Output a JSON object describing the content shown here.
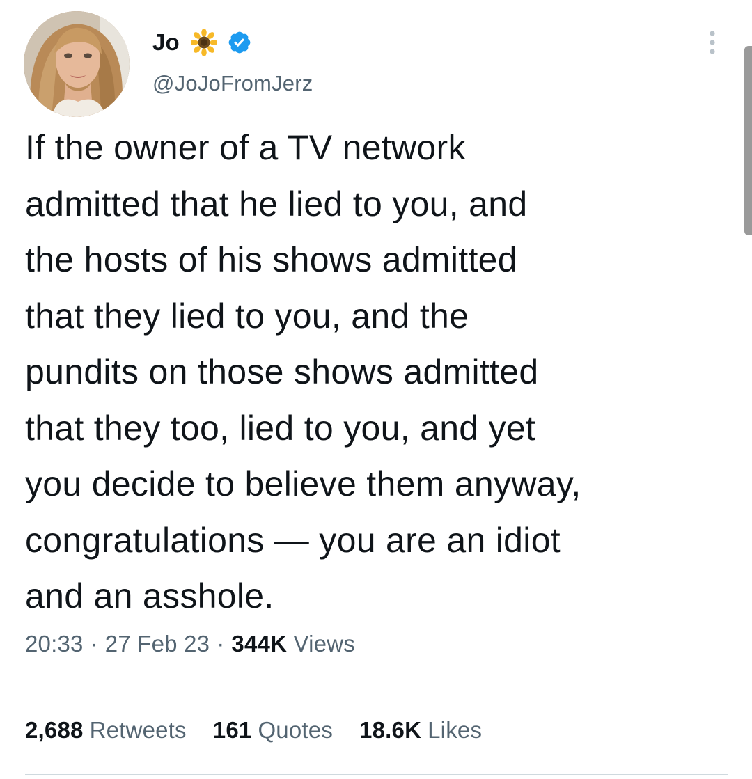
{
  "author": {
    "display_name": "Jo",
    "emoji_icon": "sunflower-icon",
    "verified_icon": "verified-badge-icon",
    "handle": "@JoJoFromJerz"
  },
  "tweet": {
    "text": "If the owner of a TV network\nadmitted that he lied to you, and\nthe hosts of his shows admitted\nthat they lied to you, and the\npundits on those shows admitted\nthat they too, lied to you, and yet\nyou decide to believe them anyway,\ncongratulations — you are an idiot\nand an asshole.",
    "time": "20:33",
    "separator": "·",
    "date": "27 Feb 23",
    "views_count": "344K",
    "views_label": "Views"
  },
  "stats": {
    "retweets_count": "2,688",
    "retweets_label": "Retweets",
    "quotes_count": "161",
    "quotes_label": "Quotes",
    "likes_count": "18.6K",
    "likes_label": "Likes"
  },
  "colors": {
    "text_primary": "#0f1419",
    "text_secondary": "#536471",
    "verified_blue": "#1d9bf0",
    "divider": "#cfd9de"
  }
}
